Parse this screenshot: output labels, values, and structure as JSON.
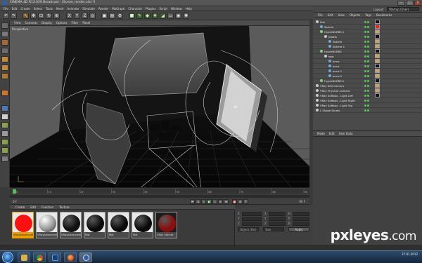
{
  "window": {
    "title": "CINEMA 4D R13.029 Broadcast - [Scene_render.c4d *]"
  },
  "menu": [
    "File",
    "Edit",
    "Create",
    "Select",
    "Tools",
    "Mesh",
    "Animate",
    "Simulate",
    "Render",
    "MoGraph",
    "Character",
    "Plugins",
    "Script",
    "Window",
    "Help"
  ],
  "viewport": {
    "menu": [
      "View",
      "Cameras",
      "Display",
      "Options",
      "Filter",
      "Panel"
    ],
    "label": "Perspective"
  },
  "om": {
    "layout_label": "Layout:",
    "layout_value": "Startup (User)",
    "tabs": [
      "File",
      "Edit",
      "View",
      "Objects",
      "Tags",
      "Bookmarks"
    ]
  },
  "objects": [
    {
      "name": "Null",
      "indent": 0,
      "color": "#c8c8c8"
    },
    {
      "name": "Sphere",
      "indent": 1,
      "color": "#6fa9d6"
    },
    {
      "name": "HyperNURBS.1",
      "indent": 1,
      "color": "#8ccf7a"
    },
    {
      "name": "jewels",
      "indent": 2,
      "color": "#c8c8c8"
    },
    {
      "name": "Sphere",
      "indent": 3,
      "color": "#6fa9d6"
    },
    {
      "name": "Sphere.1",
      "indent": 3,
      "color": "#6fa9d6"
    },
    {
      "name": "HyperNURBS",
      "indent": 1,
      "color": "#8ccf7a"
    },
    {
      "name": "legs",
      "indent": 2,
      "color": "#c8c8c8"
    },
    {
      "name": "arms",
      "indent": 3,
      "color": "#6fa9d6"
    },
    {
      "name": "arms",
      "indent": 3,
      "color": "#6fa9d6"
    },
    {
      "name": "arms.1",
      "indent": 3,
      "color": "#6fa9d6"
    },
    {
      "name": "arms.2",
      "indent": 3,
      "color": "#6fa9d6"
    },
    {
      "name": "HyperNURBS.2",
      "indent": 1,
      "color": "#8ccf7a"
    },
    {
      "name": "VRay Still Camera",
      "indent": 0,
      "color": "#c8c8c8"
    },
    {
      "name": "VRay Physical Camera",
      "indent": 0,
      "color": "#c8c8c8"
    },
    {
      "name": "VRay Softbox - Light Left",
      "indent": 0,
      "color": "#c8c8c8"
    },
    {
      "name": "VRay Softbox - Light Right",
      "indent": 0,
      "color": "#c8c8c8"
    },
    {
      "name": "VRay Softbox - Light Top",
      "indent": 0,
      "color": "#c8c8c8"
    },
    {
      "name": "L Shape Studio",
      "indent": 0,
      "color": "#c8c8c8"
    }
  ],
  "attributes": {
    "menu": [
      "Mode",
      "Edit",
      "User Data"
    ]
  },
  "materials": {
    "menu": [
      "Create",
      "Edit",
      "Function",
      "Texture"
    ],
    "items": [
      {
        "name": "VRayAdvancedMat",
        "color": "#ff1010"
      },
      {
        "name": "VRayAdvancedMat.1",
        "color": "#d8d8d8"
      },
      {
        "name": "VRayAdvancedMat.2",
        "color": "#111111"
      },
      {
        "name": "Mat",
        "color": "#0a0a0a"
      },
      {
        "name": "Mat",
        "color": "#0a0a0a"
      },
      {
        "name": "Mat",
        "color": "#0a0a0a"
      },
      {
        "name": "VRay Stdmat",
        "color": "#8a0e0e"
      }
    ]
  },
  "coords": {
    "labels": [
      "X",
      "Y",
      "Z"
    ],
    "col_b": [
      "H",
      "P",
      "B"
    ],
    "mode": "Object (Rel)",
    "size": "Size",
    "apply": "Apply"
  },
  "timeline": {
    "start": "0 F",
    "end": "90 F",
    "ticks": [
      "0",
      "10",
      "20",
      "30",
      "40",
      "50",
      "60",
      "70",
      "80",
      "90"
    ]
  },
  "watermark": {
    "brand": "pxleyes",
    "suffix": ".com"
  },
  "clock": {
    "time": "",
    "date": "27.01.2012"
  }
}
